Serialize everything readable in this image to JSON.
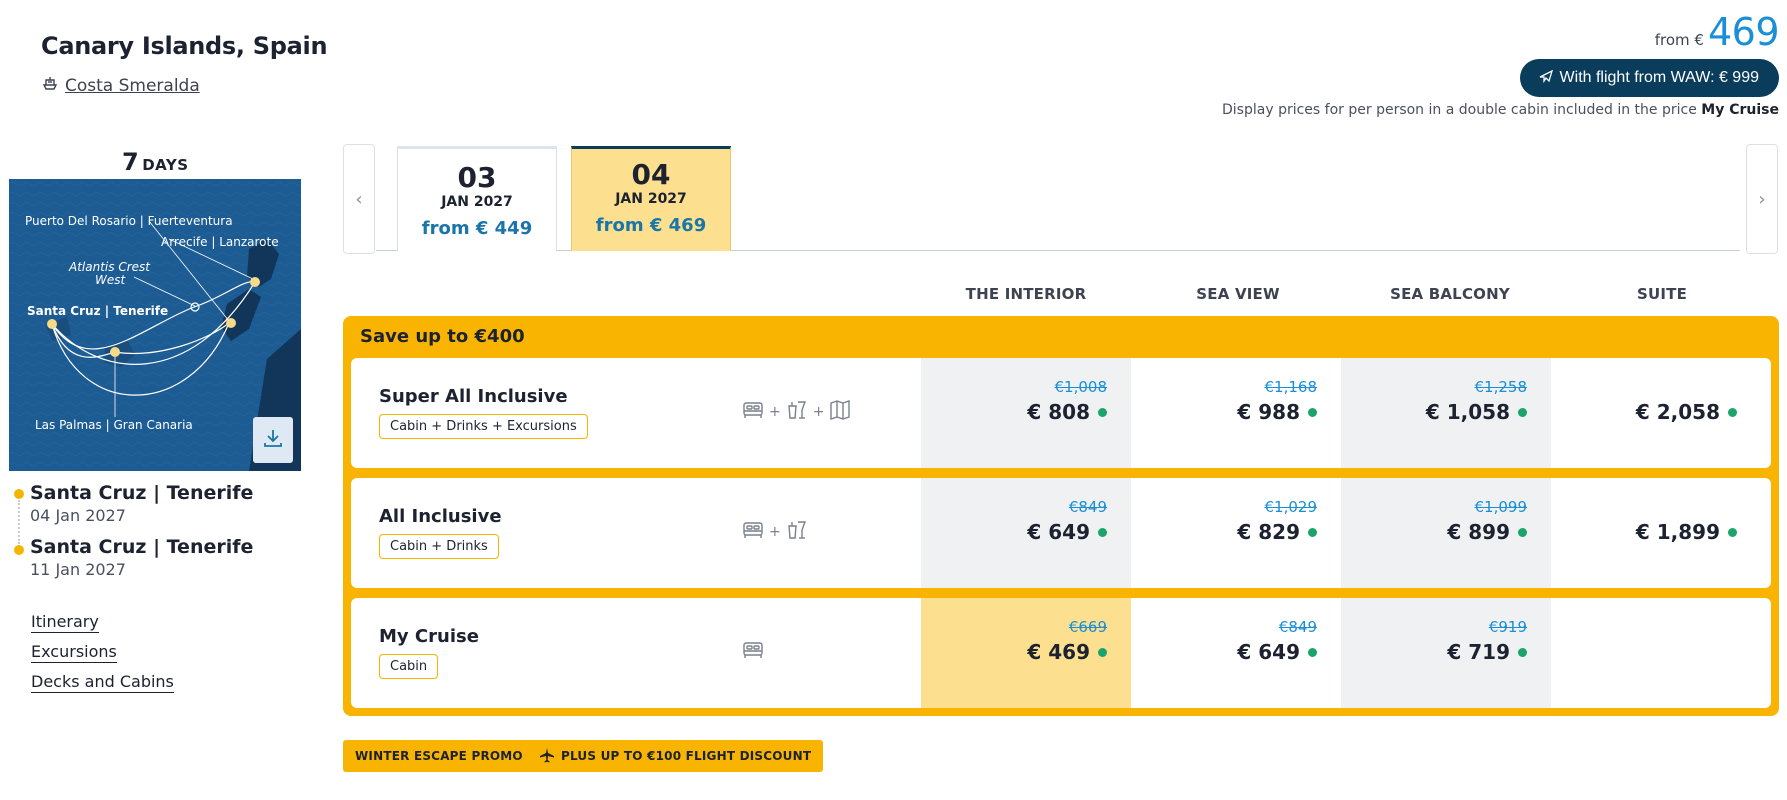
{
  "header": {
    "title": "Canary Islands, Spain",
    "ship_name": "Costa Smeralda",
    "from_label": "from €",
    "from_price": "469",
    "flight_button": "With flight from WAW: € 999",
    "display_note_prefix": "Display prices for per person in a double cabin included in the price",
    "display_note_bold": "My Cruise"
  },
  "itinerary": {
    "days_num": "7",
    "days_label": "DAYS",
    "map_labels": {
      "fuerteventura": "Puerto Del Rosario | Fuerteventura",
      "lanzarote": "Arrecife | Lanzarote",
      "atlantis1": "Atlantis Crest",
      "atlantis2": "West",
      "tenerife": "Santa Cruz | Tenerife",
      "gran_canaria": "Las Palmas | Gran Canaria"
    },
    "start_port": "Santa Cruz | Tenerife",
    "start_date": "04 Jan 2027",
    "end_port": "Santa Cruz | Tenerife",
    "end_date": "11 Jan 2027",
    "links": [
      "Itinerary",
      "Excursions",
      "Decks and Cabins"
    ]
  },
  "dates": [
    {
      "day": "03",
      "month": "JAN 2027",
      "price": "from € 449",
      "active": false
    },
    {
      "day": "04",
      "month": "JAN 2027",
      "price": "from € 469",
      "active": true
    }
  ],
  "columns": [
    "THE INTERIOR",
    "SEA VIEW",
    "SEA BALCONY",
    "SUITE"
  ],
  "save_label": "Save up to €400",
  "packages": [
    {
      "name": "Super All Inclusive",
      "badge": "Cabin + Drinks + Excursions",
      "icons": [
        "bed-icon",
        "drinks-icon",
        "map-icon"
      ],
      "prices": [
        {
          "old": "€1,008",
          "now": "€ 808"
        },
        {
          "old": "€1,168",
          "now": "€ 988"
        },
        {
          "old": "€1,258",
          "now": "€ 1,058"
        },
        {
          "old": "",
          "now": "€ 2,058"
        }
      ]
    },
    {
      "name": "All Inclusive",
      "badge": "Cabin + Drinks",
      "icons": [
        "bed-icon",
        "drinks-icon"
      ],
      "prices": [
        {
          "old": "€849",
          "now": "€ 649"
        },
        {
          "old": "€1,029",
          "now": "€ 829"
        },
        {
          "old": "€1,099",
          "now": "€ 899"
        },
        {
          "old": "",
          "now": "€ 1,899"
        }
      ]
    },
    {
      "name": "My Cruise",
      "badge": "Cabin",
      "icons": [
        "bed-icon"
      ],
      "prices": [
        {
          "old": "€669",
          "now": "€ 469"
        },
        {
          "old": "€849",
          "now": "€ 649"
        },
        {
          "old": "€919",
          "now": "€ 719"
        },
        {
          "old": "",
          "now": ""
        }
      ]
    }
  ],
  "promos": {
    "winter": "WINTER ESCAPE PROMO",
    "flight": "PLUS UP TO €100 FLIGHT DISCOUNT"
  },
  "colors": {
    "accent_yellow": "#f8b400",
    "navy": "#0a3d5c",
    "price_blue": "#1a8fd6",
    "available_green": "#1aa36b"
  }
}
